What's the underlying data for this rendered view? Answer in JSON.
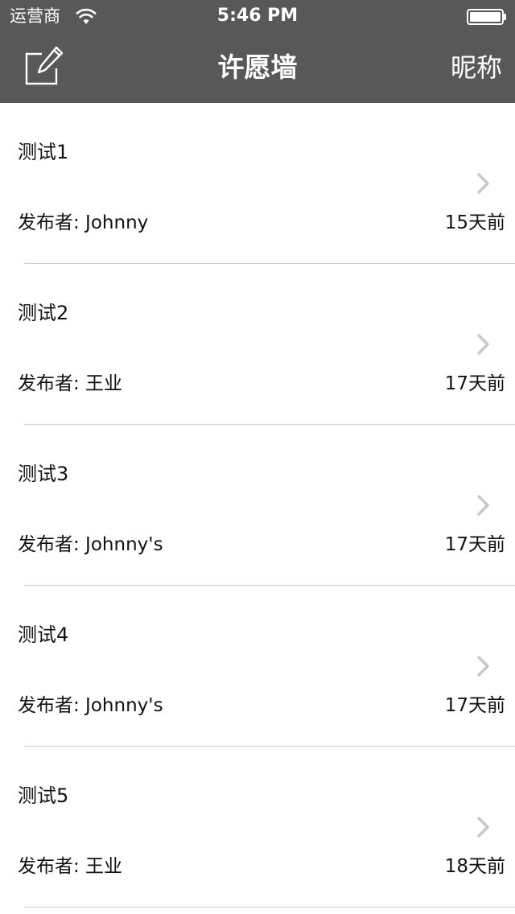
{
  "status_bar": {
    "carrier": "运营商",
    "time": "5:46 PM"
  },
  "nav": {
    "title": "许愿墙",
    "right_button": "昵称",
    "left_icon": "compose-icon"
  },
  "list": {
    "items": [
      {
        "title": "测试1",
        "author": "发布者: Johnny",
        "time": "15天前"
      },
      {
        "title": "测试2",
        "author": "发布者: 王业",
        "time": "17天前"
      },
      {
        "title": "测试3",
        "author": "发布者: Johnny's",
        "time": "17天前"
      },
      {
        "title": "测试4",
        "author": "发布者: Johnny's",
        "time": "17天前"
      },
      {
        "title": "测试5",
        "author": "发布者: 王业",
        "time": "18天前"
      }
    ]
  },
  "colors": {
    "bar_background": "#585858",
    "bar_text": "#ffffff",
    "separator": "#cfcfcf",
    "chevron": "#c7c7cc"
  }
}
